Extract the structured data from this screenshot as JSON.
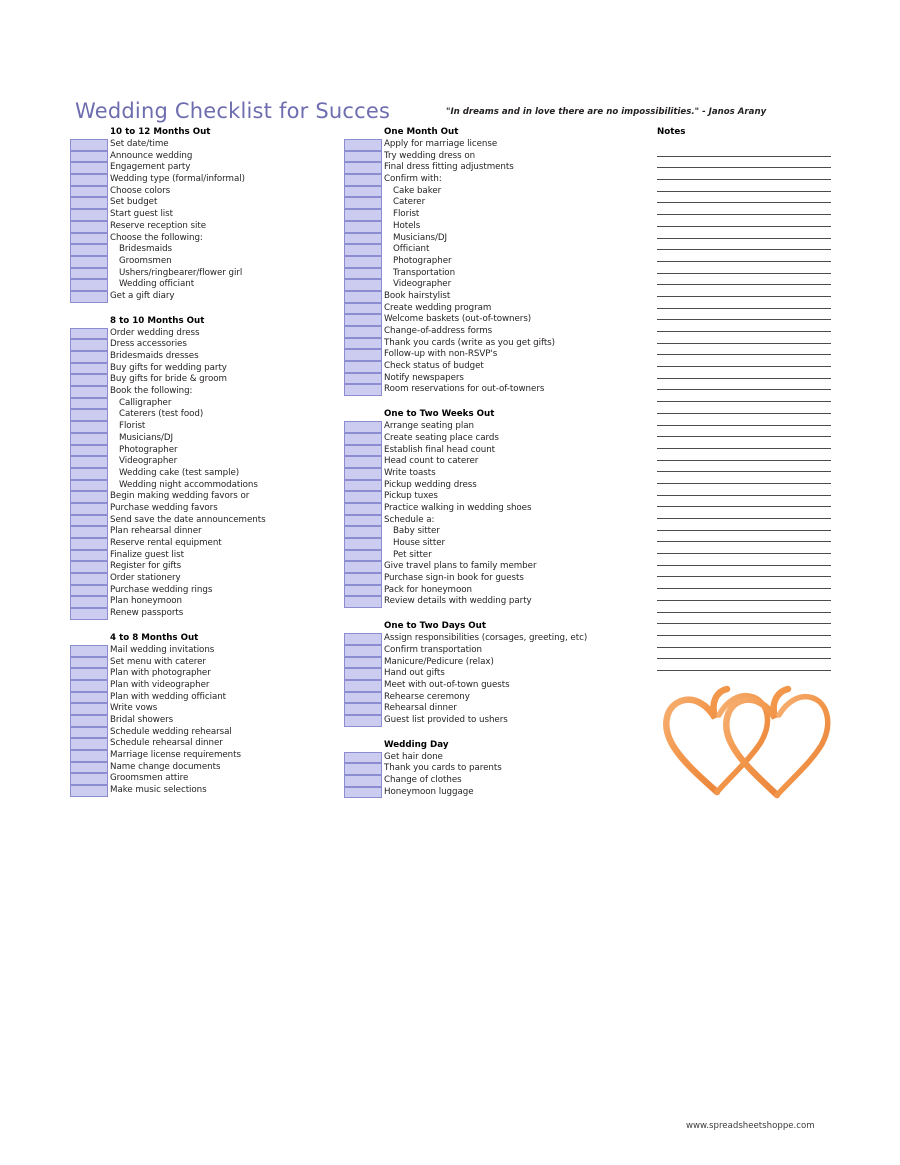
{
  "document": {
    "title": "Wedding Checklist for Succes",
    "quote": "\"In dreams and in love there are no impossibilities.\" - Janos Arany",
    "footer": "www.spreadsheetshoppe.com",
    "title_color": "#6d6db0",
    "checkbox_fill": "#ccccf0",
    "checkbox_border": "#8c8cd0",
    "heart_color": "#f2974b"
  },
  "notes": {
    "header": "Notes",
    "line_count": 45
  },
  "columns": [
    {
      "name": "left-column",
      "sections": [
        {
          "heading": "10 to 12 Months Out",
          "items": [
            {
              "label": "Set date/time",
              "indent": false
            },
            {
              "label": "Announce wedding",
              "indent": false
            },
            {
              "label": "Engagement party",
              "indent": false
            },
            {
              "label": "Wedding type (formal/informal)",
              "indent": false
            },
            {
              "label": "Choose colors",
              "indent": false
            },
            {
              "label": "Set budget",
              "indent": false
            },
            {
              "label": "Start guest list",
              "indent": false
            },
            {
              "label": "Reserve reception site",
              "indent": false
            },
            {
              "label": "Choose the following:",
              "indent": false
            },
            {
              "label": "Bridesmaids",
              "indent": true
            },
            {
              "label": "Groomsmen",
              "indent": true
            },
            {
              "label": "Ushers/ringbearer/flower girl",
              "indent": true
            },
            {
              "label": "Wedding officiant",
              "indent": true
            },
            {
              "label": "Get a gift diary",
              "indent": false
            }
          ]
        },
        {
          "heading": "8 to 10 Months Out",
          "items": [
            {
              "label": "Order wedding dress",
              "indent": false
            },
            {
              "label": "Dress accessories",
              "indent": false
            },
            {
              "label": "Bridesmaids dresses",
              "indent": false
            },
            {
              "label": "Buy gifts for wedding party",
              "indent": false
            },
            {
              "label": "Buy gifts for bride & groom",
              "indent": false
            },
            {
              "label": "Book the following:",
              "indent": false
            },
            {
              "label": "Calligrapher",
              "indent": true
            },
            {
              "label": "Caterers (test food)",
              "indent": true
            },
            {
              "label": "Florist",
              "indent": true
            },
            {
              "label": "Musicians/DJ",
              "indent": true
            },
            {
              "label": "Photographer",
              "indent": true
            },
            {
              "label": "Videographer",
              "indent": true
            },
            {
              "label": "Wedding cake (test sample)",
              "indent": true
            },
            {
              "label": "Wedding night accommodations",
              "indent": true
            },
            {
              "label": "Begin making wedding favors or",
              "indent": false
            },
            {
              "label": "Purchase wedding favors",
              "indent": false
            },
            {
              "label": "Send save the date announcements",
              "indent": false
            },
            {
              "label": "Plan rehearsal dinner",
              "indent": false
            },
            {
              "label": "Reserve rental equipment",
              "indent": false
            },
            {
              "label": "Finalize guest list",
              "indent": false
            },
            {
              "label": "Register for gifts",
              "indent": false
            },
            {
              "label": "Order stationery",
              "indent": false
            },
            {
              "label": "Purchase wedding rings",
              "indent": false
            },
            {
              "label": "Plan honeymoon",
              "indent": false
            },
            {
              "label": "Renew passports",
              "indent": false
            }
          ]
        },
        {
          "heading": "4 to 8 Months Out",
          "items": [
            {
              "label": "Mail wedding invitations",
              "indent": false
            },
            {
              "label": "Set menu with caterer",
              "indent": false
            },
            {
              "label": "Plan with photographer",
              "indent": false
            },
            {
              "label": "Plan with videographer",
              "indent": false
            },
            {
              "label": "Plan with wedding officiant",
              "indent": false
            },
            {
              "label": "Write vows",
              "indent": false
            },
            {
              "label": "Bridal showers",
              "indent": false
            },
            {
              "label": "Schedule wedding rehearsal",
              "indent": false
            },
            {
              "label": "Schedule rehearsal dinner",
              "indent": false
            },
            {
              "label": "Marriage license requirements",
              "indent": false
            },
            {
              "label": "Name change documents",
              "indent": false
            },
            {
              "label": "Groomsmen attire",
              "indent": false
            },
            {
              "label": "Make music selections",
              "indent": false
            }
          ]
        }
      ]
    },
    {
      "name": "middle-column",
      "sections": [
        {
          "heading": "One Month Out",
          "items": [
            {
              "label": "Apply for marriage license",
              "indent": false
            },
            {
              "label": "Try wedding dress on",
              "indent": false
            },
            {
              "label": "Final dress fitting adjustments",
              "indent": false
            },
            {
              "label": "Confirm with:",
              "indent": false
            },
            {
              "label": "Cake baker",
              "indent": true
            },
            {
              "label": "Caterer",
              "indent": true
            },
            {
              "label": "Florist",
              "indent": true
            },
            {
              "label": "Hotels",
              "indent": true
            },
            {
              "label": "Musicians/DJ",
              "indent": true
            },
            {
              "label": "Officiant",
              "indent": true
            },
            {
              "label": "Photographer",
              "indent": true
            },
            {
              "label": "Transportation",
              "indent": true
            },
            {
              "label": "Videographer",
              "indent": true
            },
            {
              "label": "Book hairstylist",
              "indent": false
            },
            {
              "label": "Create wedding program",
              "indent": false
            },
            {
              "label": "Welcome baskets (out-of-towners)",
              "indent": false
            },
            {
              "label": "Change-of-address forms",
              "indent": false
            },
            {
              "label": "Thank you cards (write as you get gifts)",
              "indent": false
            },
            {
              "label": "Follow-up with non-RSVP's",
              "indent": false
            },
            {
              "label": "Check status of budget",
              "indent": false
            },
            {
              "label": "Notify newspapers",
              "indent": false
            },
            {
              "label": "Room reservations for out-of-towners",
              "indent": false
            }
          ]
        },
        {
          "heading": "One to Two Weeks Out",
          "items": [
            {
              "label": "Arrange seating plan",
              "indent": false
            },
            {
              "label": "Create seating place cards",
              "indent": false
            },
            {
              "label": "Establish final head count",
              "indent": false
            },
            {
              "label": "Head count to caterer",
              "indent": false
            },
            {
              "label": "Write toasts",
              "indent": false
            },
            {
              "label": "Pickup wedding dress",
              "indent": false
            },
            {
              "label": "Pickup tuxes",
              "indent": false
            },
            {
              "label": "Practice walking in wedding shoes",
              "indent": false
            },
            {
              "label": "Schedule a:",
              "indent": false
            },
            {
              "label": "Baby sitter",
              "indent": true
            },
            {
              "label": "House sitter",
              "indent": true
            },
            {
              "label": "Pet sitter",
              "indent": true
            },
            {
              "label": "Give travel plans to family member",
              "indent": false
            },
            {
              "label": "Purchase sign-in book for guests",
              "indent": false
            },
            {
              "label": "Pack for honeymoon",
              "indent": false
            },
            {
              "label": "Review details with wedding party",
              "indent": false
            }
          ]
        },
        {
          "heading": "One to Two Days Out",
          "items": [
            {
              "label": "Assign responsibilities (corsages, greeting, etc)",
              "indent": false
            },
            {
              "label": "Confirm transportation",
              "indent": false
            },
            {
              "label": "Manicure/Pedicure (relax)",
              "indent": false
            },
            {
              "label": "Hand out gifts",
              "indent": false
            },
            {
              "label": "Meet with out-of-town guests",
              "indent": false
            },
            {
              "label": "Rehearse ceremony",
              "indent": false
            },
            {
              "label": "Rehearsal dinner",
              "indent": false
            },
            {
              "label": "Guest list provided to ushers",
              "indent": false
            }
          ]
        },
        {
          "heading": "Wedding Day",
          "items": [
            {
              "label": "Get hair done",
              "indent": false
            },
            {
              "label": "Thank you cards to parents",
              "indent": false
            },
            {
              "label": "Change of clothes",
              "indent": false
            },
            {
              "label": "Honeymoon luggage",
              "indent": false
            }
          ]
        }
      ]
    }
  ]
}
